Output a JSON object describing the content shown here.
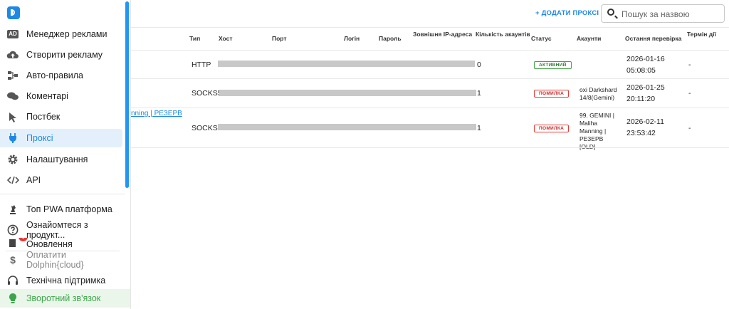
{
  "sidebar": {
    "items": [
      {
        "label": "Менеджер реклами",
        "icon": "ad-icon"
      },
      {
        "label": "Створити рекламу",
        "icon": "cloud-upload-icon"
      },
      {
        "label": "Авто-правила",
        "icon": "workflow-icon"
      },
      {
        "label": "Коментарі",
        "icon": "comments-icon"
      },
      {
        "label": "Постбек",
        "icon": "cursor-icon"
      },
      {
        "label": "Проксі",
        "icon": "plug-icon"
      },
      {
        "label": "Налаштування",
        "icon": "gear-icon"
      },
      {
        "label": "API",
        "icon": "code-icon"
      }
    ],
    "lower_items": [
      {
        "label": "Топ PWA платформа",
        "icon": "chess-icon"
      },
      {
        "label": "Ознайомтеся з продукт...",
        "icon": "question-icon"
      },
      {
        "label": "Оновлення",
        "icon": "updates-icon",
        "badge": "6"
      },
      {
        "label": "Оплатити Dolphin{cloud}",
        "icon": "dollar-icon"
      },
      {
        "label": "Технічна підтримка",
        "icon": "headset-icon"
      },
      {
        "label": "Зворотний зв'язок",
        "icon": "bulb-icon"
      }
    ]
  },
  "toolbar": {
    "add_label": "+ ДОДАТИ ПРОКСІ",
    "search_placeholder": "Пошук за назвою"
  },
  "table": {
    "columns": [
      "Тип",
      "Хост",
      "Порт",
      "Логін",
      "Пароль",
      "Зовнішня IP-адреса",
      "Кількість акаунтів",
      "Статус",
      "Акаунти",
      "Остання перевірка",
      "Термін дії"
    ],
    "rows": [
      {
        "type": "HTTP",
        "count": "0",
        "status": "АКТИВНИЙ",
        "status_kind": "ok",
        "accounts": "",
        "date": "2026-01-16",
        "time": "05:08:05",
        "expiry": "-"
      },
      {
        "type": "SOCKS5",
        "count": "1",
        "status": "ПОМИЛКА",
        "status_kind": "err",
        "accounts": "oxi Darkshard 14/8(Gemini)",
        "date": "2026-01-25",
        "time": "20:11:20",
        "expiry": "-"
      },
      {
        "type": "SOCKS5",
        "count": "1",
        "status": "ПОМИЛКА",
        "status_kind": "err",
        "accounts": "99. GEMINI | Maliha Manning | РЕЗЕРВ [OLD]",
        "date": "2026-02-11",
        "time": "23:53:42",
        "expiry": "-",
        "name_link": "nning | РЕЗЕРВ"
      }
    ]
  },
  "colors": {
    "accent": "#1e88e5",
    "success": "#43a047",
    "error": "#e53935",
    "feedback": "#3fa34d"
  }
}
